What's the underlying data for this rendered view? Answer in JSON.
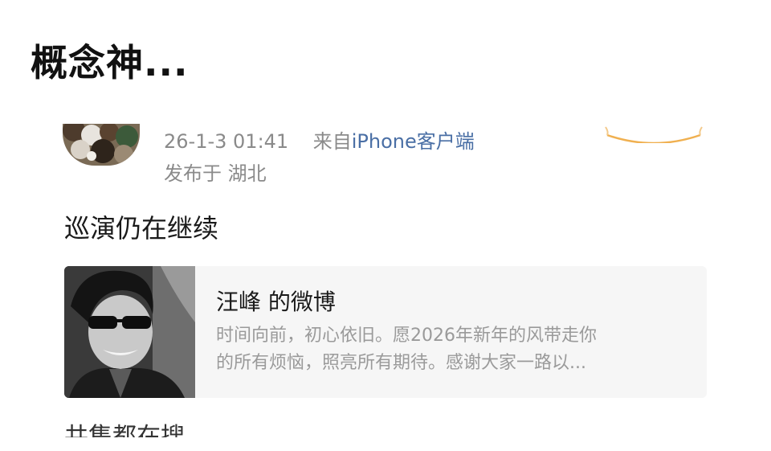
{
  "page": {
    "title": "概念神..."
  },
  "post": {
    "timestamp": "26-1-3 01:41",
    "source_prefix": "来自",
    "source_link": "iPhone客户端",
    "location": "发布于 湖北",
    "text": "巡演仍在继续",
    "shared_card": {
      "title": "汪峰 的微博",
      "desc_line1": "时间向前，初心依旧。愿2026年新年的风带走你",
      "desc_line2": "的所有烦恼，照亮所有期待。感谢大家一路以..."
    },
    "cut_off_text": "共集都在搜"
  },
  "colors": {
    "meta_gray": "#8a8a8a",
    "link_blue": "#4a6fa5",
    "card_bg": "#f6f6f6",
    "accent_orange": "#f0b050"
  },
  "icons": {
    "avatar": "user-avatar-image",
    "card_image": "portrait-photo"
  }
}
